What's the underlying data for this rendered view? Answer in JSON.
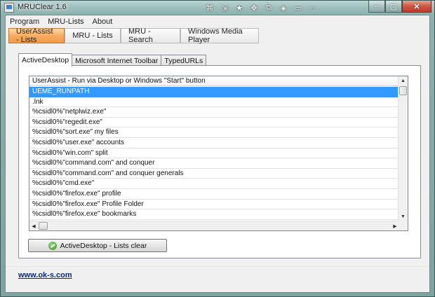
{
  "window": {
    "title": "MRUClear 1.6",
    "title_tools": [
      "⌘",
      "⇲",
      "★",
      "✥",
      "⧉",
      "◈",
      "▭",
      "⇔",
      "✕"
    ],
    "minimize": "–",
    "maximize": "▢",
    "close": "✕"
  },
  "menu": [
    "Program",
    "MRU-Lists",
    "About"
  ],
  "toolbar": {
    "tabs": [
      {
        "label": "UserAssist - Lists",
        "active": true
      },
      {
        "label": "MRU - Lists",
        "active": false
      },
      {
        "label": "MRU - Search",
        "active": false
      },
      {
        "label": "Windows Media Player",
        "active": false
      }
    ]
  },
  "tabs": [
    {
      "label": "ActiveDesktop",
      "active": true
    },
    {
      "label": "Microsoft Internet Toolbar",
      "active": false
    },
    {
      "label": "TypedURLs",
      "active": false
    }
  ],
  "list": {
    "header": "UserAssist - Run via Desktop or Windows \"Start\" button",
    "rows": [
      "UEME_RUNPATH",
      ".lnk",
      "%csidl0%\"netplwiz.exe\"",
      "%csidl0%\"regedit.exe\"",
      "%csidl0%\"sort.exe\" my files",
      "%csidl0%\"user.exe\" accounts",
      "%csidl0%\"win.com\" split",
      "%csidl0%\"command.com\" and conquer",
      "%csidl0%\"command.com\" and conquer generals",
      "%csidl0%\"cmd.exe\"",
      "%csidl0%\"firefox.exe\" profile",
      "%csidl0%\"firefox.exe\" Profile Folder",
      "%csidl0%\"firefox.exe\" bookmarks"
    ],
    "selected_index": 0
  },
  "clear_button": "ActiveDesktop - Lists clear",
  "link": "www.ok-s.com",
  "icons": {
    "app": "app-icon",
    "clear": "recycle-icon",
    "scroll_up": "▲",
    "scroll_down": "▼",
    "scroll_left": "◀",
    "scroll_right": "▶"
  }
}
